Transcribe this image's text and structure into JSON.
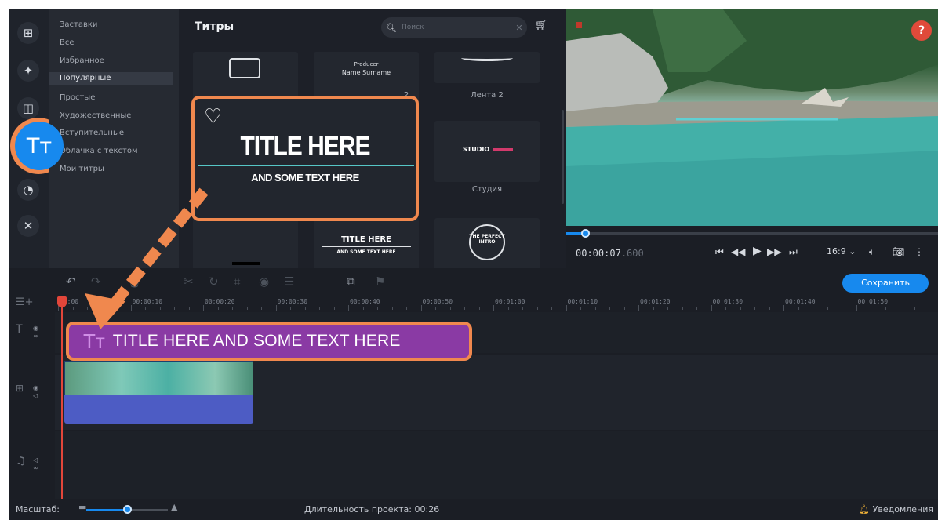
{
  "categories": {
    "items": [
      "Заставки",
      "Все",
      "Избранное",
      "Популярные",
      "Простые",
      "Художественные",
      "Вступительные",
      "Облачка с текстом",
      "Мои титры"
    ],
    "selected_index": 3
  },
  "titles_panel": {
    "heading": "Титры",
    "search_placeholder": "Поиск",
    "thumbs": [
      {
        "caption": "",
        "art_top": "Producer",
        "art_bottom": "Name Surname"
      },
      {
        "caption": "Лента 2"
      },
      {
        "caption": "Студия",
        "art": "STUDIO"
      },
      {
        "caption": "",
        "art_top": "TITLE HERE",
        "art_bottom": "AND SOME TEXT HERE"
      },
      {
        "caption": "",
        "art": "THE PERFECT INTRO"
      }
    ],
    "partial_caption": "2"
  },
  "popup": {
    "title": "TITLE HERE",
    "subtitle": "AND SOME TEXT HERE"
  },
  "preview": {
    "help_label": "?",
    "timecode_main": "00:00:07.",
    "timecode_ms": "600",
    "aspect": "16:9",
    "progress_fraction": 0.05
  },
  "toolbar": {
    "save_label": "Сохранить"
  },
  "ruler": {
    "labels": [
      "00:00",
      "00:00:10",
      "00:00:20",
      "00:00:30",
      "00:00:40",
      "00:00:50",
      "00:01:00",
      "00:01:10",
      "00:01:20",
      "00:01:30",
      "00:01:40",
      "00:01:50"
    ]
  },
  "timeline": {
    "title_clip_icon": "Тт",
    "title_clip_label": "TITLE HERE AND SOME TEXT HERE"
  },
  "status": {
    "zoom_label": "Масштаб:",
    "zoom_fraction": 0.5,
    "duration_label": "Длительность проекта: 00:26",
    "notifications_label": "Уведомления"
  },
  "icons": {
    "rail": [
      "import-icon",
      "magic-icon",
      "transitions-icon",
      "titles-icon",
      "stickers-icon",
      "tools-icon"
    ]
  },
  "colors": {
    "accent": "#1789ee",
    "highlight": "#f0884e",
    "title_clip": "#8a3aa4",
    "audio_clip": "#4d5cc4",
    "playhead": "#e2463a"
  }
}
